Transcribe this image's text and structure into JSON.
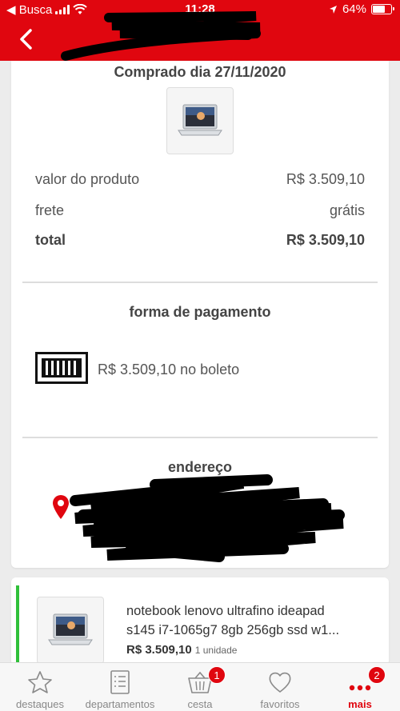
{
  "status_bar": {
    "back_app": "◀ Busca",
    "time": "11:28",
    "battery": "64%"
  },
  "purchase": {
    "date_label": "Comprado dia 27/11/2020",
    "rows": [
      {
        "label": "valor do produto",
        "value": "R$ 3.509,10"
      },
      {
        "label": "frete",
        "value": "grátis"
      },
      {
        "label": "total",
        "value": "R$ 3.509,10"
      }
    ]
  },
  "payment": {
    "title": "forma de pagamento",
    "text": "R$ 3.509,10 no boleto"
  },
  "address": {
    "title": "endereço"
  },
  "item": {
    "name_line1": "notebook lenovo ultrafino ideapad",
    "name_line2": "s145 i7-1065g7 8gb  256gb ssd w1...",
    "price": "R$ 3.509,10",
    "quantity": "1 unidade"
  },
  "tabbar": {
    "tabs": [
      {
        "label": "destaques",
        "icon": "star-icon"
      },
      {
        "label": "departamentos",
        "icon": "list-icon"
      },
      {
        "label": "cesta",
        "icon": "basket-icon",
        "badge": "1"
      },
      {
        "label": "favoritos",
        "icon": "heart-icon"
      },
      {
        "label": "mais",
        "icon": "more-icon",
        "badge": "2"
      }
    ]
  },
  "colors": {
    "brand": "#e0060f",
    "status_green": "#30c03a"
  }
}
